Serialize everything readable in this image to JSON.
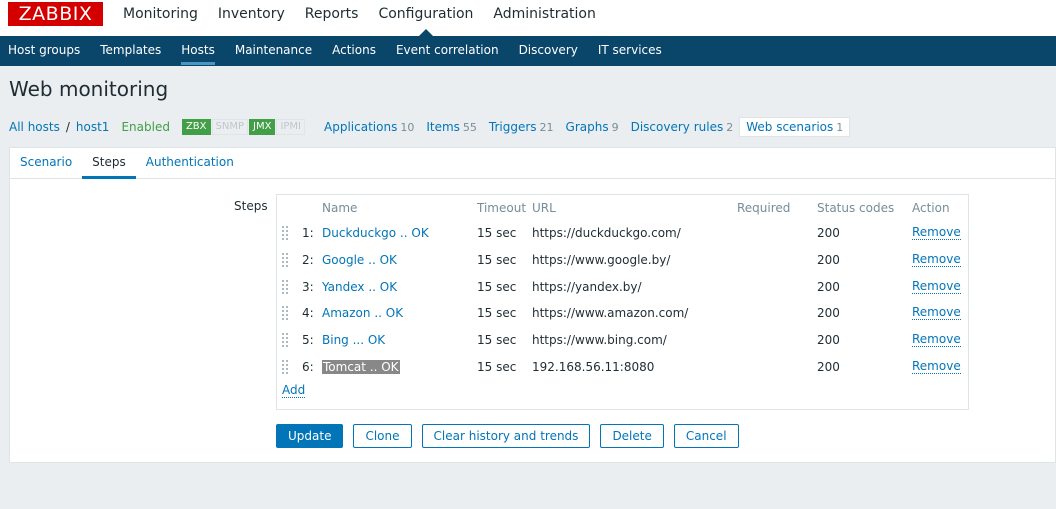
{
  "logo": "ZABBIX",
  "main_menu": [
    "Monitoring",
    "Inventory",
    "Reports",
    "Configuration",
    "Administration"
  ],
  "sub_menu": [
    "Host groups",
    "Templates",
    "Hosts",
    "Maintenance",
    "Actions",
    "Event correlation",
    "Discovery",
    "IT services"
  ],
  "page_title": "Web monitoring",
  "host_nav": {
    "all_hosts": "All hosts",
    "separator": "/",
    "host": "host1",
    "status": "Enabled",
    "badges": [
      "ZBX",
      "SNMP",
      "JMX",
      "IPMI"
    ],
    "items": [
      {
        "label": "Applications",
        "count": "10"
      },
      {
        "label": "Items",
        "count": "55"
      },
      {
        "label": "Triggers",
        "count": "21"
      },
      {
        "label": "Graphs",
        "count": "9"
      },
      {
        "label": "Discovery rules",
        "count": "2"
      },
      {
        "label": "Web scenarios",
        "count": "1"
      }
    ]
  },
  "tabs": [
    "Scenario",
    "Steps",
    "Authentication"
  ],
  "steps_label": "Steps",
  "table": {
    "headers": {
      "name": "Name",
      "timeout": "Timeout",
      "url": "URL",
      "required": "Required",
      "status_codes": "Status codes",
      "action": "Action"
    },
    "rows": [
      {
        "num": "1:",
        "name": "Duckduckgo .. OK",
        "timeout": "15 sec",
        "url": "https://duckduckgo.com/",
        "required": "",
        "status": "200",
        "action": "Remove"
      },
      {
        "num": "2:",
        "name": "Google .. OK",
        "timeout": "15 sec",
        "url": "https://www.google.by/",
        "required": "",
        "status": "200",
        "action": "Remove"
      },
      {
        "num": "3:",
        "name": "Yandex .. OK",
        "timeout": "15 sec",
        "url": "https://yandex.by/",
        "required": "",
        "status": "200",
        "action": "Remove"
      },
      {
        "num": "4:",
        "name": "Amazon .. OK",
        "timeout": "15 sec",
        "url": "https://www.amazon.com/",
        "required": "",
        "status": "200",
        "action": "Remove"
      },
      {
        "num": "5:",
        "name": "Bing ... OK",
        "timeout": "15 sec",
        "url": "https://www.bing.com/",
        "required": "",
        "status": "200",
        "action": "Remove"
      },
      {
        "num": "6:",
        "name": "Tomcat .. OK",
        "timeout": "15 sec",
        "url": "192.168.56.11:8080",
        "required": "",
        "status": "200",
        "action": "Remove"
      }
    ],
    "add": "Add"
  },
  "buttons": {
    "update": "Update",
    "clone": "Clone",
    "clear": "Clear history and trends",
    "delete": "Delete",
    "cancel": "Cancel"
  }
}
